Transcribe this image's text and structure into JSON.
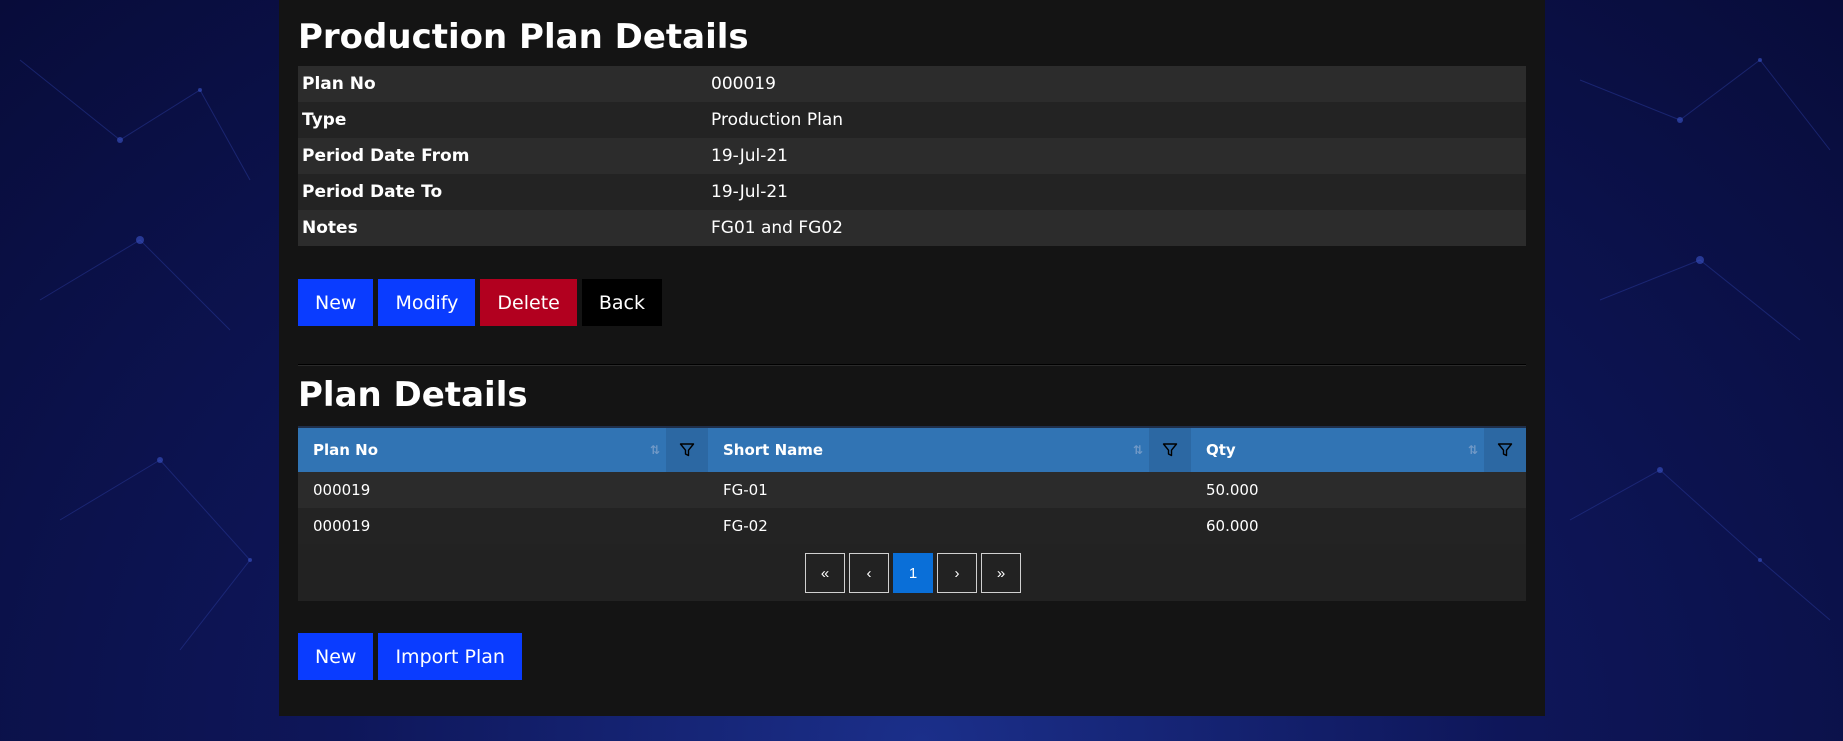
{
  "details": {
    "title": "Production Plan Details",
    "rows": [
      {
        "label": "Plan No",
        "value": "000019"
      },
      {
        "label": "Type",
        "value": "Production Plan"
      },
      {
        "label": "Period Date From",
        "value": "19-Jul-21"
      },
      {
        "label": "Period Date To",
        "value": "19-Jul-21"
      },
      {
        "label": "Notes",
        "value": "FG01 and FG02"
      }
    ],
    "buttons": {
      "new": "New",
      "modify": "Modify",
      "delete": "Delete",
      "back": "Back"
    }
  },
  "plan_details": {
    "title": "Plan Details",
    "columns": [
      "Plan No",
      "Short Name",
      "Qty"
    ],
    "rows": [
      [
        "000019",
        "FG-01",
        "50.000"
      ],
      [
        "000019",
        "FG-02",
        "60.000"
      ]
    ],
    "pager": {
      "first": "«",
      "prev": "‹",
      "current": "1",
      "next": "›",
      "last": "»"
    },
    "buttons": {
      "new": "New",
      "import": "Import Plan"
    }
  },
  "icons": {
    "sort": "sort-icon",
    "filter": "filter-icon"
  },
  "colors": {
    "primary": "#0a3cff",
    "danger": "#b2001f",
    "grid_header": "#3174b4",
    "pager_active": "#0a6fd8"
  }
}
